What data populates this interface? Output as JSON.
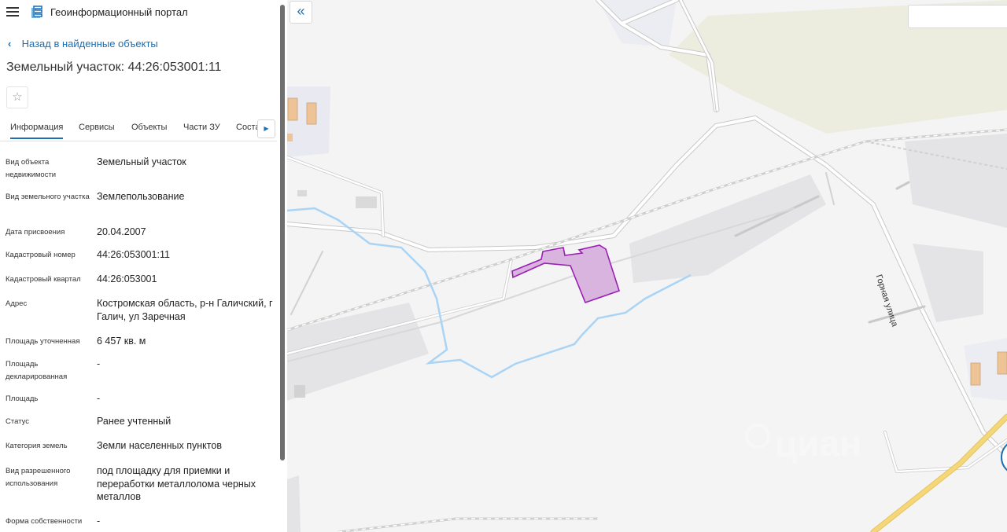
{
  "app": {
    "title": "Геоинформационный портал"
  },
  "nav": {
    "back_label": "Назад в найденные объекты"
  },
  "page": {
    "title": "Земельный участок: 44:26:053001:11"
  },
  "tabs": [
    {
      "label": "Информация",
      "active": true
    },
    {
      "label": "Сервисы"
    },
    {
      "label": "Объекты"
    },
    {
      "label": "Части ЗУ"
    },
    {
      "label": "Соста"
    }
  ],
  "properties": [
    {
      "label": "Вид объекта недвижимости",
      "value": "Земельный участок"
    },
    {
      "label": "Вид земельного участка",
      "value": "Землепользование"
    },
    {
      "label": "Дата присвоения",
      "value": "20.04.2007"
    },
    {
      "label": "Кадастровый номер",
      "value": "44:26:053001:11"
    },
    {
      "label": "Кадастровый квартал",
      "value": "44:26:053001"
    },
    {
      "label": "Адрес",
      "value": "Костромская область, р-н Галичский, г Галич, ул Заречная"
    },
    {
      "label": "Площадь уточненная",
      "value": "6 457 кв. м"
    },
    {
      "label": "Площадь декларированная",
      "value": "-"
    },
    {
      "label": "Площадь",
      "value": "-"
    },
    {
      "label": "Статус",
      "value": "Ранее учтенный"
    },
    {
      "label": "Категория земель",
      "value": "Земли населенных пунктов"
    },
    {
      "label": "Вид разрешенного использования",
      "value": "под площадку для приемки и переработки металлолома черных металлов"
    },
    {
      "label": "Форма собственности",
      "value": "-"
    }
  ],
  "map": {
    "street_label": "Горная улица",
    "watermark": "циан"
  },
  "colors": {
    "accent": "#1a6fb5",
    "parcel_stroke": "#9b1fb5",
    "parcel_fill": "#d9b4df",
    "water": "#a9d4f5",
    "road_major": "#f5d77a"
  }
}
